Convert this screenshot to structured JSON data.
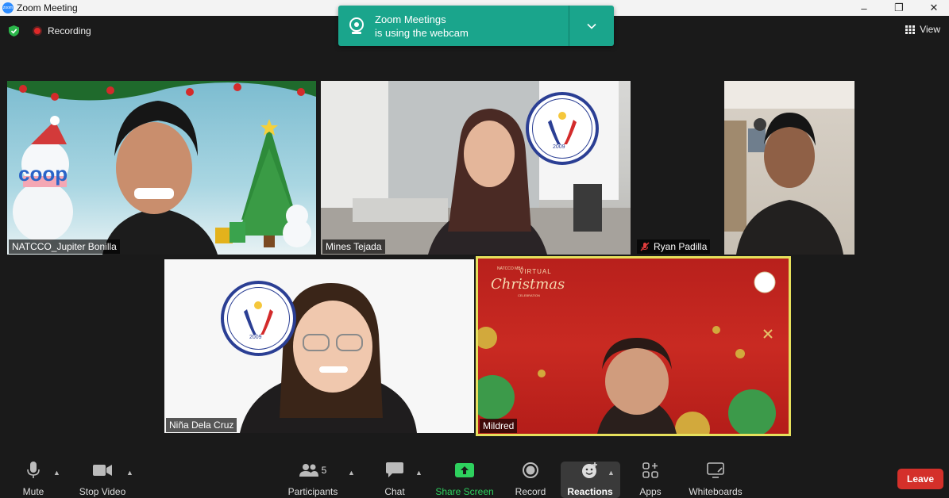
{
  "window": {
    "app_icon_text": "zoom",
    "title": "Zoom Meeting",
    "minimize": "–",
    "restore": "❐",
    "close": "✕"
  },
  "top": {
    "recording_label": "Recording",
    "view_label": "View"
  },
  "toast": {
    "line1": "Zoom Meetings",
    "line2": "is using the webcam"
  },
  "tiles": {
    "t1": "NATCCO_Jupiter Bonilla",
    "t2": "Mines Tejada",
    "t3": "Ryan Padilla",
    "t4": "Niña Dela Cruz",
    "t5": "Mildred"
  },
  "tile_overlays": {
    "coop_text": "coop",
    "seal_text": "MUTUAL BENEFITS ASSOCIATION INC",
    "seal_year": "2009",
    "virtual": "VIRTUAL",
    "christmas": "Christmas",
    "natcco_small": "NATCCO MBA",
    "celebration": "CELEBRATION"
  },
  "toolbar": {
    "mute": "Mute",
    "stop_video": "Stop Video",
    "participants": "Participants",
    "participants_count": "5",
    "chat": "Chat",
    "share_screen": "Share Screen",
    "record": "Record",
    "reactions": "Reactions",
    "apps": "Apps",
    "whiteboards": "Whiteboards",
    "leave": "Leave"
  },
  "colors": {
    "toast": "#1aa58c",
    "active_speaker_border": "#e6e05c",
    "share_green": "#2ed15e",
    "leave_red": "#d4302a"
  }
}
